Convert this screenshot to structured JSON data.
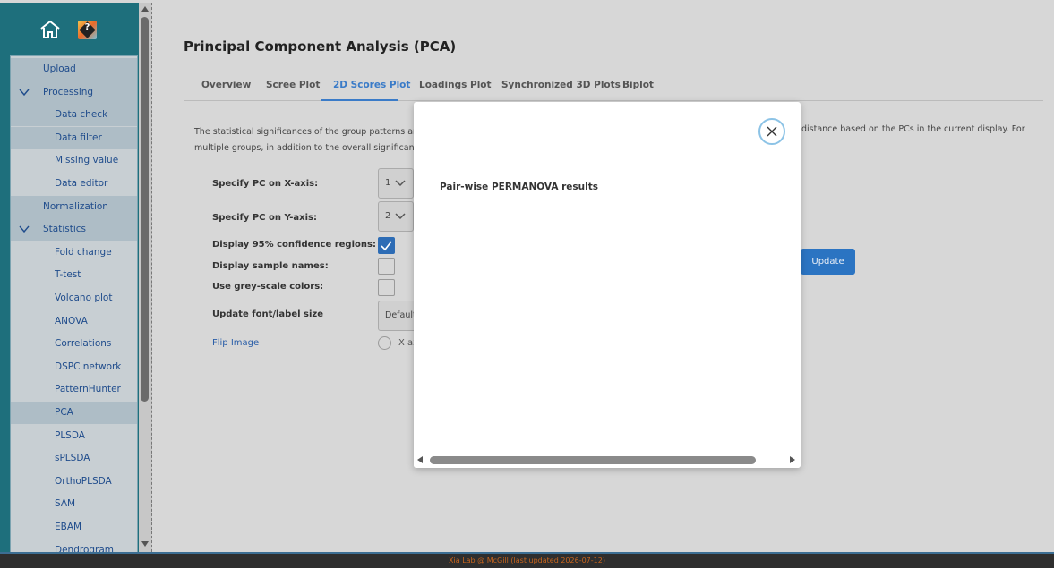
{
  "sidebar": {
    "items": [
      {
        "label": "Upload",
        "level": 1,
        "highlighted": true
      },
      {
        "label": "Processing",
        "level": 1,
        "highlighted": true,
        "expandable": true
      },
      {
        "label": "Data check",
        "level": 2,
        "highlighted": true
      },
      {
        "label": "Data filter",
        "level": 2,
        "highlighted": true
      },
      {
        "label": "Missing value",
        "level": 2,
        "highlighted": false
      },
      {
        "label": "Data editor",
        "level": 2,
        "highlighted": false
      },
      {
        "label": "Normalization",
        "level": 1,
        "highlighted": true
      },
      {
        "label": "Statistics",
        "level": 1,
        "highlighted": true,
        "expandable": true
      },
      {
        "label": "Fold change",
        "level": 2,
        "highlighted": false
      },
      {
        "label": "T-test",
        "level": 2,
        "highlighted": false
      },
      {
        "label": "Volcano plot",
        "level": 2,
        "highlighted": false
      },
      {
        "label": "ANOVA",
        "level": 2,
        "highlighted": false
      },
      {
        "label": "Correlations",
        "level": 2,
        "highlighted": false
      },
      {
        "label": "DSPC network",
        "level": 2,
        "highlighted": false
      },
      {
        "label": "PatternHunter",
        "level": 2,
        "highlighted": false
      },
      {
        "label": "PCA",
        "level": 2,
        "highlighted": true
      },
      {
        "label": "PLSDA",
        "level": 2,
        "highlighted": false
      },
      {
        "label": "sPLSDA",
        "level": 2,
        "highlighted": false
      },
      {
        "label": "OrthoPLSDA",
        "level": 2,
        "highlighted": false
      },
      {
        "label": "SAM",
        "level": 2,
        "highlighted": false
      },
      {
        "label": "EBAM",
        "level": 2,
        "highlighted": false
      },
      {
        "label": "Dendrogram",
        "level": 2,
        "highlighted": false
      }
    ]
  },
  "main": {
    "title": "Principal Component Analysis (PCA)",
    "tabs": [
      {
        "label": "Overview"
      },
      {
        "label": "Scree Plot"
      },
      {
        "label": "2D Scores Plot",
        "active": true
      },
      {
        "label": "Loadings Plot"
      },
      {
        "label": "Synchronized 3D Plots"
      },
      {
        "label": "Biplot"
      }
    ],
    "description_line1": "The statistical significances of the group patterns are",
    "description_line2": "multiple groups, in addition to the overall significance",
    "description_right": "distance based on the PCs in the current display. For",
    "form": {
      "x_axis_label": "Specify PC on X-axis:",
      "x_axis_value": "1",
      "y_axis_label": "Specify PC on Y-axis:",
      "y_axis_value": "2",
      "confidence_label": "Display 95% confidence regions:",
      "confidence_checked": true,
      "sample_names_label": "Display sample names:",
      "sample_names_checked": false,
      "greyscale_label": "Use grey-scale colors:",
      "greyscale_checked": false,
      "font_label": "Update font/label size",
      "font_value": "Default",
      "flip_label": "Flip Image",
      "flip_option": "X ax"
    },
    "update_button": "Update"
  },
  "modal": {
    "title": "Pair-wise PERMANOVA results"
  },
  "footer": {
    "text": "Xia Lab @ McGill   (last updated 2026-07-12)"
  },
  "colors": {
    "sidebar_bg": "#1e6f7c",
    "accent": "#2b74c2",
    "footer_text": "#c8651d"
  }
}
